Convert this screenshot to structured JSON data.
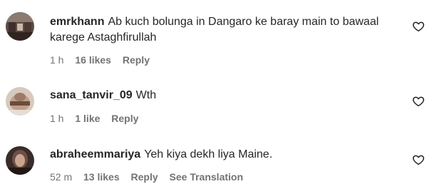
{
  "comments": [
    {
      "username": "emrkhann",
      "text": "Ab kuch bolunga in Dangaro ke baray main to bawaal karege Astaghfirullah",
      "time": "1 h",
      "likes": "16 likes",
      "reply": "Reply",
      "avatar_icon": "profile-photo-icon"
    },
    {
      "username": "sana_tanvir_09",
      "text": "Wth",
      "time": "1 h",
      "likes": "1 like",
      "reply": "Reply",
      "avatar_icon": "profile-photo-icon"
    },
    {
      "username": "abraheemmariya",
      "text": "Yeh kiya dekh liya Maine.",
      "time": "52 m",
      "likes": "13 likes",
      "reply": "Reply",
      "see_translation": "See Translation",
      "avatar_icon": "profile-photo-icon"
    }
  ],
  "icons": {
    "like": "heart-outline-icon"
  },
  "colors": {
    "text": "#262626",
    "meta": "#737373"
  }
}
